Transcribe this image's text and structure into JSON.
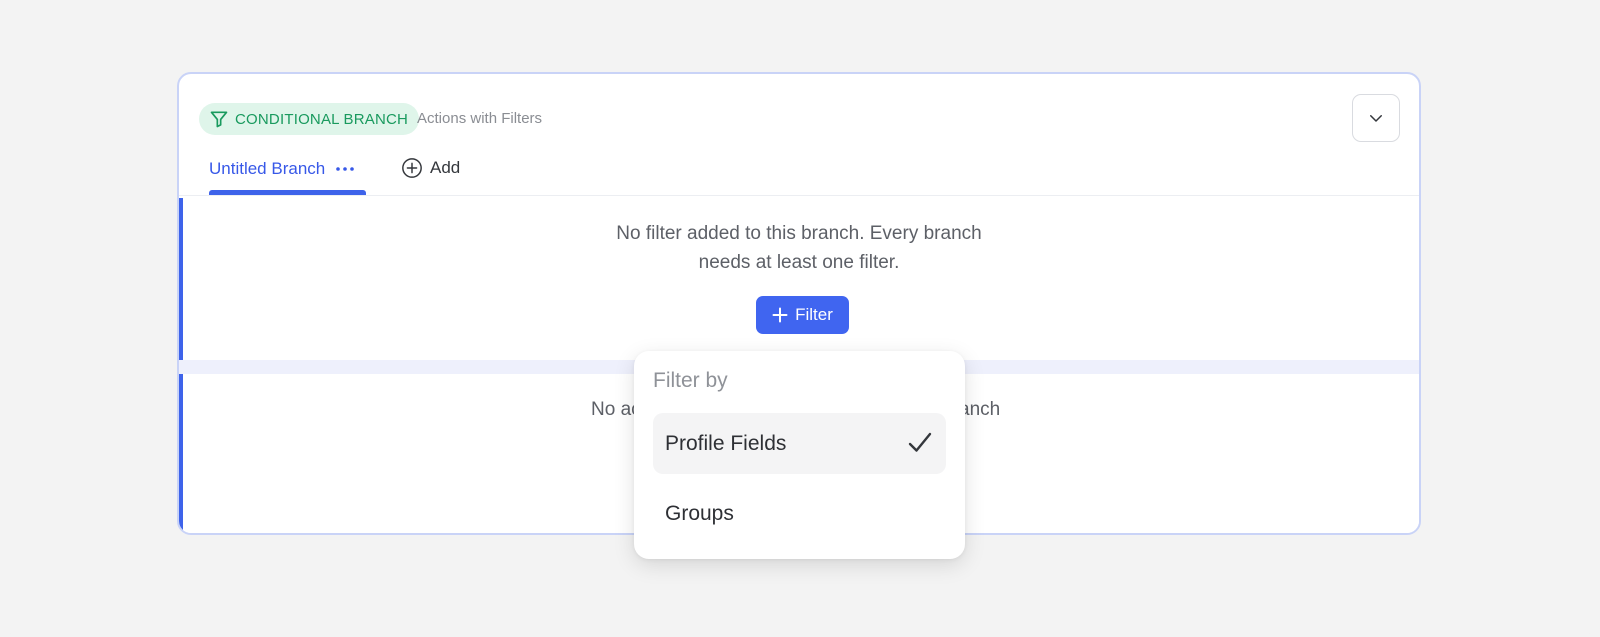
{
  "header": {
    "badge_label": "CONDITIONAL BRANCH",
    "badge_icon": "filter-icon",
    "subtitle": "Actions with Filters",
    "collapse_icon": "chevron-down-icon"
  },
  "tabs": [
    {
      "label": "Untitled Branch",
      "active": true,
      "menu_icon": "more-horizontal-icon"
    }
  ],
  "add_tab": {
    "label": "Add",
    "icon": "plus-circle-icon"
  },
  "branches": [
    {
      "empty_message_line1": "No filter added to this branch. Every branch",
      "empty_message_line2": "needs at least one filter.",
      "filter_button_label": "Filter"
    },
    {
      "empty_message_left": "No ac",
      "empty_message_right": "anch"
    }
  ],
  "dropdown": {
    "title": "Filter by",
    "options": [
      {
        "label": "Profile Fields",
        "selected": true
      },
      {
        "label": "Groups",
        "selected": false
      }
    ]
  },
  "colors": {
    "accent": "#3e63ea",
    "badge_bg": "#dff5ea",
    "badge_text": "#199a5e",
    "card_border": "#c9d3f7"
  }
}
